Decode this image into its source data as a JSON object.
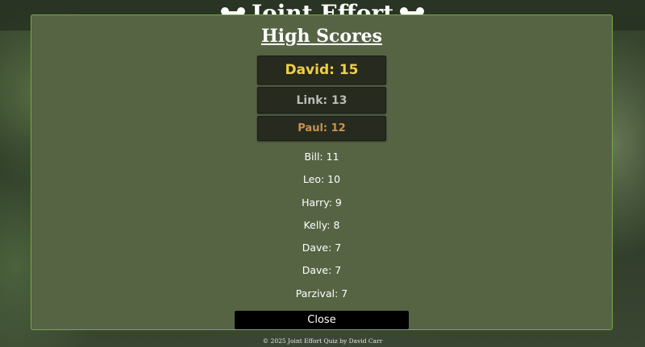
{
  "site": {
    "title": "Joint Effort",
    "footer": "© 2025 Joint Effort Quiz by David Carr"
  },
  "modal": {
    "title": "High Scores",
    "podium": [
      {
        "text": "David: 15",
        "rank": "gold",
        "color": "#f0cf45"
      },
      {
        "text": "Link: 13",
        "rank": "silver",
        "color": "#b9bcb3"
      },
      {
        "text": "Paul: 12",
        "rank": "bronze",
        "color": "#c9934f"
      }
    ],
    "scores": [
      "Bill: 11",
      "Leo: 10",
      "Harry: 9",
      "Kelly: 8",
      "Dave: 7",
      "Dave: 7",
      "Parzival: 7"
    ],
    "close_label": "Close"
  },
  "icons": [
    "bone-icon"
  ]
}
